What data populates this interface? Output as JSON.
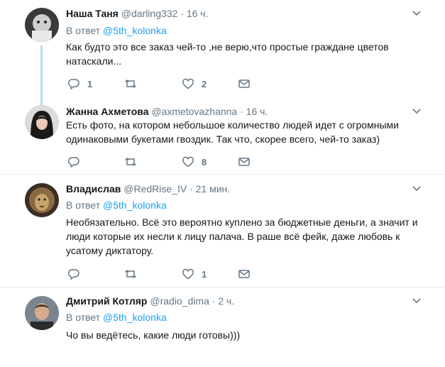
{
  "tweets": [
    {
      "name": "Наша Таня",
      "handle": "@darling332",
      "time": "16 ч.",
      "reply_prefix": "В ответ",
      "reply_to": "@5th_kolonka",
      "text": [
        "Как будто это все заказ чей-то ,не верю,что простые граждане цветов",
        "натаскали..."
      ],
      "replies": "1",
      "retweets": "",
      "likes": "2"
    },
    {
      "name": "Жанна Ахметова",
      "handle": "@axmetovazhanna",
      "time": "16 ч.",
      "text": [
        "Есть фото, на котором небольшое количество людей идет с огромными",
        "одинаковыми букетами гвоздик. Так что, скорее всего, чей-то заказ)"
      ],
      "replies": "",
      "retweets": "",
      "likes": "8"
    },
    {
      "name": "Владислав",
      "handle": "@RedRise_IV",
      "time": "21 мин.",
      "reply_prefix": "В ответ",
      "reply_to": "@5th_kolonka",
      "text": [
        "Необязательно. Всё это вероятно куплено за бюджетные деньги, а значит и",
        "люди которые их несли к лицу палача. В раше всё фейк, даже любовь к",
        "усатому диктатору."
      ],
      "replies": "",
      "retweets": "",
      "likes": "1"
    },
    {
      "name": "Дмитрий Котляр",
      "handle": "@radio_dima",
      "time": "2 ч.",
      "reply_prefix": "В ответ",
      "reply_to": "@5th_kolonka",
      "text": [
        "Чо вы ведётесь, какие люди готовы)))"
      ]
    }
  ],
  "separator": "·",
  "colors": {
    "link": "#1da1f2",
    "muted": "#657786",
    "divider": "#e6ecf0",
    "thread": "#b4dcf6"
  }
}
